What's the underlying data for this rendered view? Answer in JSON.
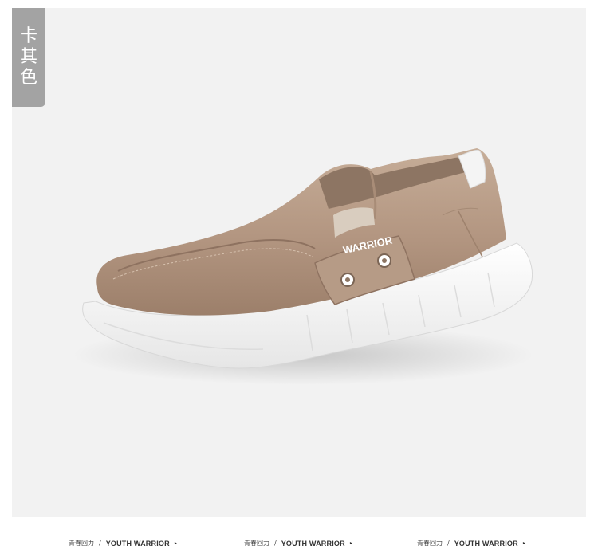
{
  "color_tag": {
    "label": "卡其色"
  },
  "product_image": {
    "subject": "shoe",
    "shoe_color": "#b59a84",
    "sole_color": "#ffffff",
    "logo_text": "WARRIOR"
  },
  "footer": {
    "items": [
      {
        "cn": "青春回力",
        "sep": "/",
        "en": "YOUTH WARRIOR",
        "arrow": "▸"
      },
      {
        "cn": "青春回力",
        "sep": "/",
        "en": "YOUTH WARRIOR",
        "arrow": "▸"
      },
      {
        "cn": "青春回力",
        "sep": "/",
        "en": "YOUTH WARRIOR",
        "arrow": "▸"
      }
    ]
  }
}
